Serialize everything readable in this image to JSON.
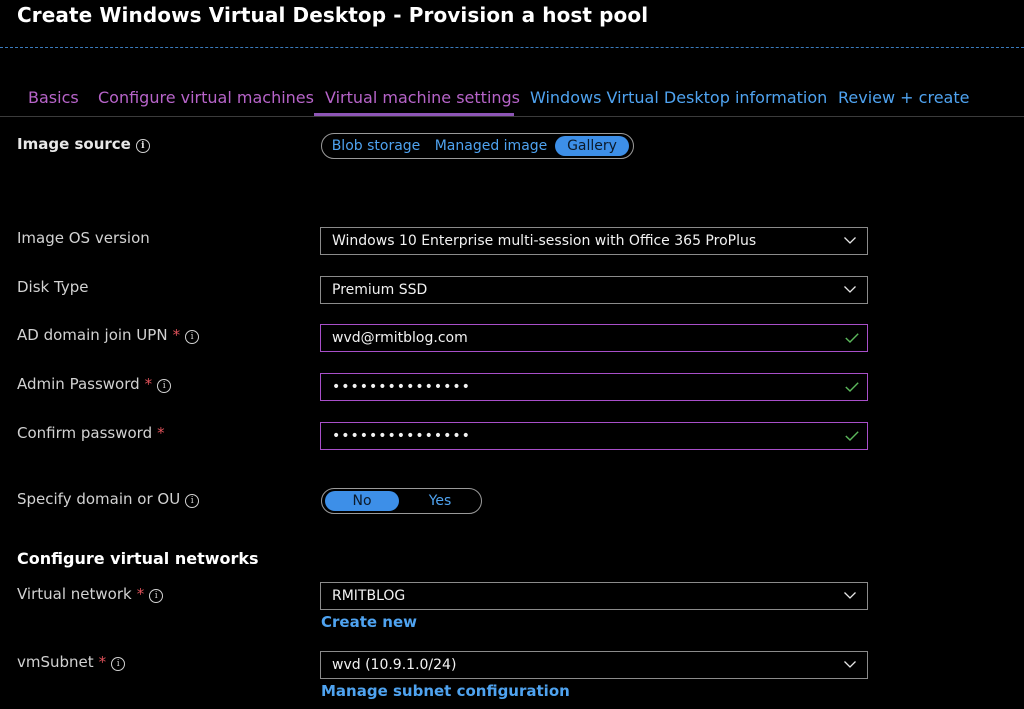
{
  "page": {
    "title": "Create Windows Virtual Desktop - Provision a host pool"
  },
  "tabs": [
    {
      "label": "Basics"
    },
    {
      "label": "Configure virtual machines"
    },
    {
      "label": "Virtual machine settings"
    },
    {
      "label": "Windows Virtual Desktop information"
    },
    {
      "label": "Review + create"
    }
  ],
  "form": {
    "image_source": {
      "label": "Image source",
      "options": [
        "Blob storage",
        "Managed image",
        "Gallery"
      ],
      "selected": "Gallery"
    },
    "image_os_version": {
      "label": "Image OS version",
      "value": "Windows 10 Enterprise multi-session with Office 365 ProPlus"
    },
    "disk_type": {
      "label": "Disk Type",
      "value": "Premium SSD"
    },
    "ad_domain_join_upn": {
      "label": "AD domain join UPN",
      "required_mark": "*",
      "value": "wvd@rmitblog.com"
    },
    "admin_password": {
      "label": "Admin Password",
      "required_mark": "*",
      "value": "•••••••••••••••"
    },
    "confirm_password": {
      "label": "Confirm password",
      "required_mark": "*",
      "value": "•••••••••••••••"
    },
    "specify_domain_or_ou": {
      "label": "Specify domain or OU",
      "options": [
        "No",
        "Yes"
      ],
      "selected": "No"
    }
  },
  "networks": {
    "section_title": "Configure virtual networks",
    "virtual_network": {
      "label": "Virtual network",
      "required_mark": "*",
      "value": "RMITBLOG",
      "link": "Create new"
    },
    "vm_subnet": {
      "label": "vmSubnet",
      "required_mark": "*",
      "value": "wvd (10.9.1.0/24)",
      "link": "Manage subnet configuration"
    }
  },
  "icons": {
    "info": "info-icon",
    "dropdown": "chevron-down-icon",
    "valid": "checkmark-icon"
  },
  "colors": {
    "background": "#000000",
    "accent_link": "#4fa3f0",
    "visited_tab": "#b764c9",
    "required": "#e0525a",
    "valid": "#5cb85c",
    "segment_selected": "#3d8fe8"
  }
}
